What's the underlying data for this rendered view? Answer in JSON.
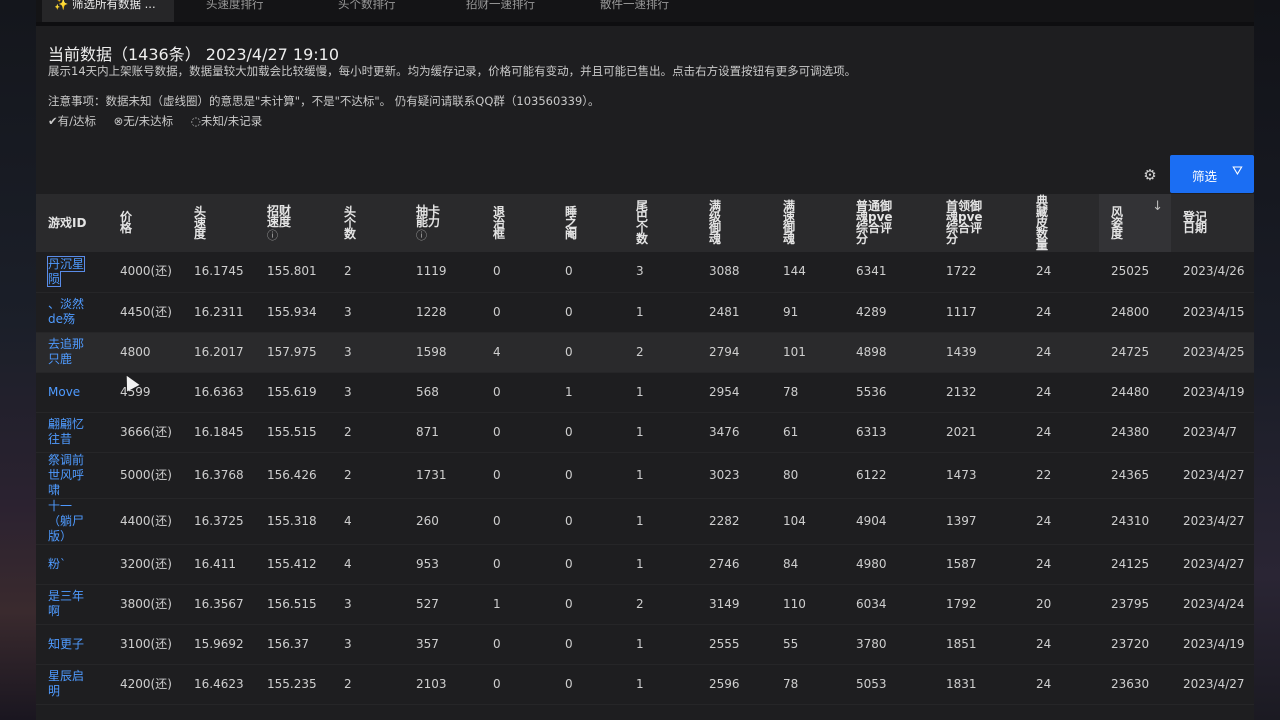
{
  "tabs": [
    {
      "label": "✨ 筛选所有数据 ...",
      "active": true
    },
    {
      "label": "头速度排行"
    },
    {
      "label": "头个数排行"
    },
    {
      "label": "招财一速排行"
    },
    {
      "label": "散件一速排行"
    }
  ],
  "header": {
    "title": "当前数据（1436条） 2023/4/27 19:10",
    "subtitle": "展示14天内上架账号数据，数据量较大加载会比较缓慢，每小时更新。均为缓存记录，价格可能有变动，并且可能已售出。点击右方设置按钮有更多可调选项。",
    "note": "注意事项：数据未知（虚线圈）的意思是\"未计算\"，不是\"不达标\"。 仍有疑问请联系QQ群（103560339）。",
    "legend": [
      "✔有/达标",
      "⊗无/未达标",
      "◌未知/未记录"
    ]
  },
  "toolbar": {
    "filter_label": "筛选",
    "gear_icon": "gear-icon",
    "filter_icon": "funnel-icon"
  },
  "colors": {
    "accent": "#1b6ef3",
    "link": "#4f9bff",
    "panel": "#1e1e20",
    "header_row": "#2a2a2c"
  },
  "table": {
    "columns": [
      {
        "label": "游戏ID"
      },
      {
        "label": "价\n格"
      },
      {
        "label": "头\n速\n度"
      },
      {
        "label": "招财\n速度",
        "info": "ⓘ"
      },
      {
        "label": "头\n个\n数"
      },
      {
        "label": "抽卡\n能力",
        "info": "ⓘ"
      },
      {
        "label": "退\n治\n框"
      },
      {
        "label": "睡\n之\n阉"
      },
      {
        "label": "尾\n巴\n个\n数"
      },
      {
        "label": "满\n级\n御\n魂"
      },
      {
        "label": "满\n速\n御\n魂"
      },
      {
        "label": "普通御\n魂pve\n综合评\n分"
      },
      {
        "label": "首领御\n魂pve\n综合评\n分"
      },
      {
        "label": "典\n藏\n皮\n数\n量"
      },
      {
        "label": "风\n姿\n度",
        "sort": "↓"
      },
      {
        "label": "登记\n日期"
      }
    ],
    "rows": [
      [
        "丹沉星\n陨",
        "4000(还)",
        "16.1745",
        "155.801",
        "2",
        "1119",
        "0",
        "0",
        "3",
        "3088",
        "144",
        "6341",
        "1722",
        "24",
        "25025",
        "2023/4/26"
      ],
      [
        "、淡然\nde殇",
        "4450(还)",
        "16.2311",
        "155.934",
        "3",
        "1228",
        "0",
        "0",
        "1",
        "2481",
        "91",
        "4289",
        "1117",
        "24",
        "24800",
        "2023/4/15"
      ],
      [
        "去追那\n只鹿",
        "4800",
        "16.2017",
        "157.975",
        "3",
        "1598",
        "4",
        "0",
        "2",
        "2794",
        "101",
        "4898",
        "1439",
        "24",
        "24725",
        "2023/4/25"
      ],
      [
        "Move",
        "4599",
        "16.6363",
        "155.619",
        "3",
        "568",
        "0",
        "1",
        "1",
        "2954",
        "78",
        "5536",
        "2132",
        "24",
        "24480",
        "2023/4/19"
      ],
      [
        "翩翩忆\n往昔",
        "3666(还)",
        "16.1845",
        "155.515",
        "2",
        "871",
        "0",
        "0",
        "1",
        "3476",
        "61",
        "6313",
        "2021",
        "24",
        "24380",
        "2023/4/7"
      ],
      [
        "祭调前\n世风呼\n啸",
        "5000(还)",
        "16.3768",
        "156.426",
        "2",
        "1731",
        "0",
        "0",
        "1",
        "3023",
        "80",
        "6122",
        "1473",
        "22",
        "24365",
        "2023/4/27"
      ],
      [
        "十一\n（躺尸\n版）",
        "4400(还)",
        "16.3725",
        "155.318",
        "4",
        "260",
        "0",
        "0",
        "1",
        "2282",
        "104",
        "4904",
        "1397",
        "24",
        "24310",
        "2023/4/27"
      ],
      [
        "粉`",
        "3200(还)",
        "16.411",
        "155.412",
        "4",
        "953",
        "0",
        "0",
        "1",
        "2746",
        "84",
        "4980",
        "1587",
        "24",
        "24125",
        "2023/4/27"
      ],
      [
        "是三年\n啊",
        "3800(还)",
        "16.3567",
        "156.515",
        "3",
        "527",
        "1",
        "0",
        "2",
        "3149",
        "110",
        "6034",
        "1792",
        "20",
        "23795",
        "2023/4/24"
      ],
      [
        "知更子",
        "3100(还)",
        "15.9692",
        "156.37",
        "3",
        "357",
        "0",
        "0",
        "1",
        "2555",
        "55",
        "3780",
        "1851",
        "24",
        "23720",
        "2023/4/19"
      ],
      [
        "星辰启\n明",
        "4200(还)",
        "16.4623",
        "155.235",
        "2",
        "2103",
        "0",
        "0",
        "1",
        "2596",
        "78",
        "5053",
        "1831",
        "24",
        "23630",
        "2023/4/27"
      ]
    ]
  }
}
